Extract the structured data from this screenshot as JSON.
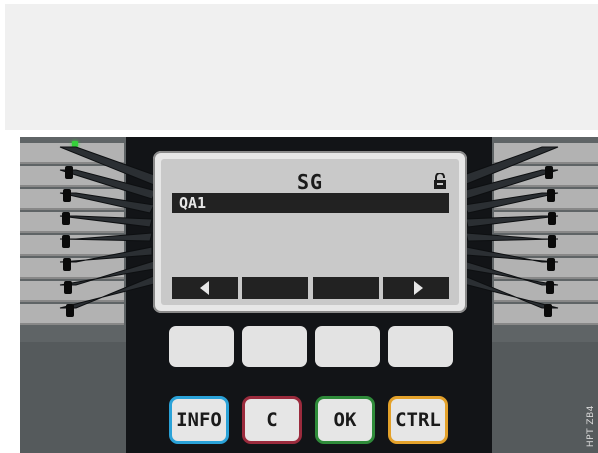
{
  "display": {
    "title": "SG",
    "selected_item": "QA1",
    "softkeys": [
      "left-arrow",
      "",
      "",
      "right-arrow"
    ]
  },
  "function_keys": {
    "info": "INFO",
    "c": "C",
    "ok": "OK",
    "ctrl": "CTRL"
  },
  "side_code": "HPT ZB4",
  "colors": {
    "info": "#2aa2d8",
    "c": "#9b2b3d",
    "ok": "#2f8b3a",
    "ctrl": "#e3a12a",
    "led": "#35d13a"
  },
  "icons": {
    "lock": "lock-icon",
    "softkey_left": "arrow-left-icon",
    "softkey_right": "arrow-right-icon"
  }
}
